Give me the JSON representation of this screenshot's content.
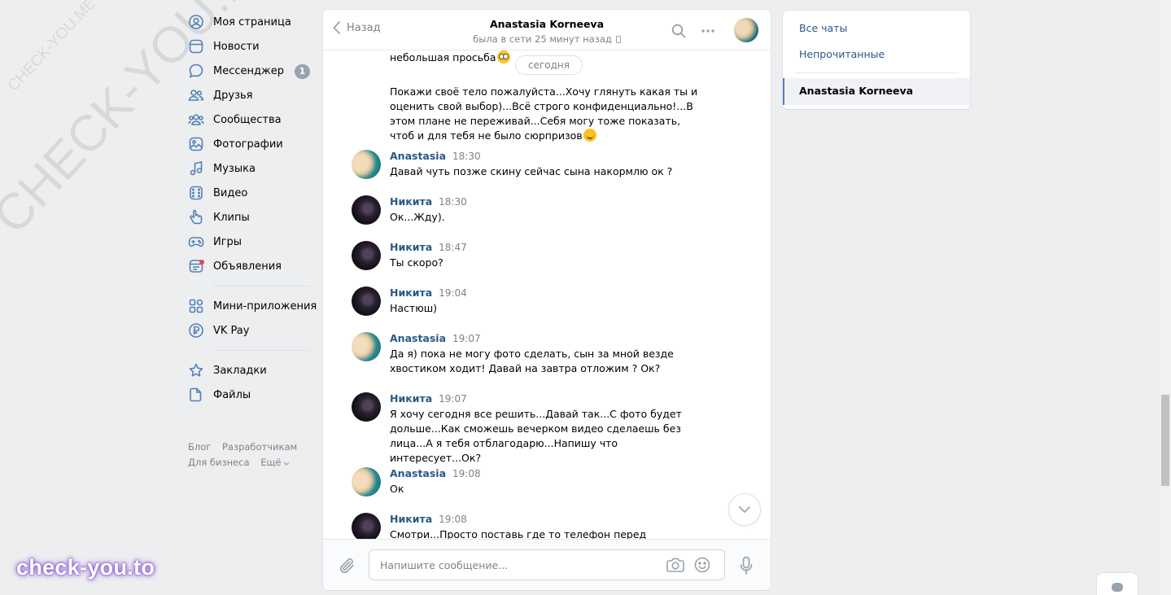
{
  "watermarks": {
    "diagonal_big": "CHECK-YOU.ME",
    "diagonal_small": "CHECK-YOU.ME",
    "bottom": "check-you.to"
  },
  "nav": {
    "items": [
      {
        "label": "Моя страница",
        "icon": "user-circle-icon"
      },
      {
        "label": "Новости",
        "icon": "news-icon"
      },
      {
        "label": "Мессенджер",
        "icon": "message-icon",
        "badge": "1"
      },
      {
        "label": "Друзья",
        "icon": "friends-icon"
      },
      {
        "label": "Сообщества",
        "icon": "communities-icon"
      },
      {
        "label": "Фотографии",
        "icon": "photo-icon"
      },
      {
        "label": "Музыка",
        "icon": "music-icon"
      },
      {
        "label": "Видео",
        "icon": "video-icon"
      },
      {
        "label": "Клипы",
        "icon": "clips-icon"
      },
      {
        "label": "Игры",
        "icon": "gamepad-icon"
      },
      {
        "label": "Объявления",
        "icon": "ads-icon"
      }
    ],
    "apps": [
      {
        "label": "Мини-приложения",
        "icon": "mini-apps-icon"
      },
      {
        "label": "VK Pay",
        "icon": "vkpay-icon"
      }
    ],
    "extra": [
      {
        "label": "Закладки",
        "icon": "star-icon"
      },
      {
        "label": "Файлы",
        "icon": "file-icon"
      }
    ],
    "footer": {
      "blog": "Блог",
      "dev": "Разработчикам",
      "business": "Для бизнеса",
      "more": "Ещё"
    }
  },
  "chat": {
    "back_label": "Назад",
    "title": "Anastasia Korneeva",
    "subtitle": "была в сети 25 минут назад",
    "date_pill": "сегодня",
    "top_text_1": "небольшая просьба",
    "top_text_2": "Покажи своё тело пожалуйста...Хочу глянуть какая ты и оценить свой выбор)...Всё строго конфиденциально!...В этом плане не переживай...Себя могу тоже показать, чтоб и для тебя не было сюрпризов",
    "messages": [
      {
        "name": "Anastasia",
        "time": "18:30",
        "text": "Давай чуть позже скину сейчас сына накормлю ок ?"
      },
      {
        "name": "Никита",
        "time": "18:30",
        "text": "Ок...Жду)."
      },
      {
        "name": "Никита",
        "time": "18:47",
        "text": "Ты скоро?"
      },
      {
        "name": "Никита",
        "time": "19:04",
        "text": "Настюш)"
      },
      {
        "name": "Anastasia",
        "time": "19:07",
        "text": "Да я) пока не могу фото сделать, сын за мной везде хвостиком ходит! Давай на завтра отложим ? Ок?"
      },
      {
        "name": "Никита",
        "time": "19:07",
        "text": "Я хочу сегодня все решить...Давай так...С фото будет дольше...Как сможешь вечерком видео сделаешь без лица...А я тебя отблагодарю...Напишу что интересует...Ок?"
      },
      {
        "name": "Anastasia",
        "time": "19:08",
        "text": "Ок"
      },
      {
        "name": "Никита",
        "time": "19:08",
        "text": "Смотри...Просто поставь где то телефон перед"
      }
    ],
    "input_placeholder": "Напишите сообщение..."
  },
  "right_panel": {
    "all_chats": "Все чаты",
    "unread": "Непрочитанные",
    "active_chat": "Anastasia Korneeva"
  },
  "colors": {
    "link": "#2a5885",
    "bg": "#edeef0",
    "accent": "#5181b8"
  }
}
